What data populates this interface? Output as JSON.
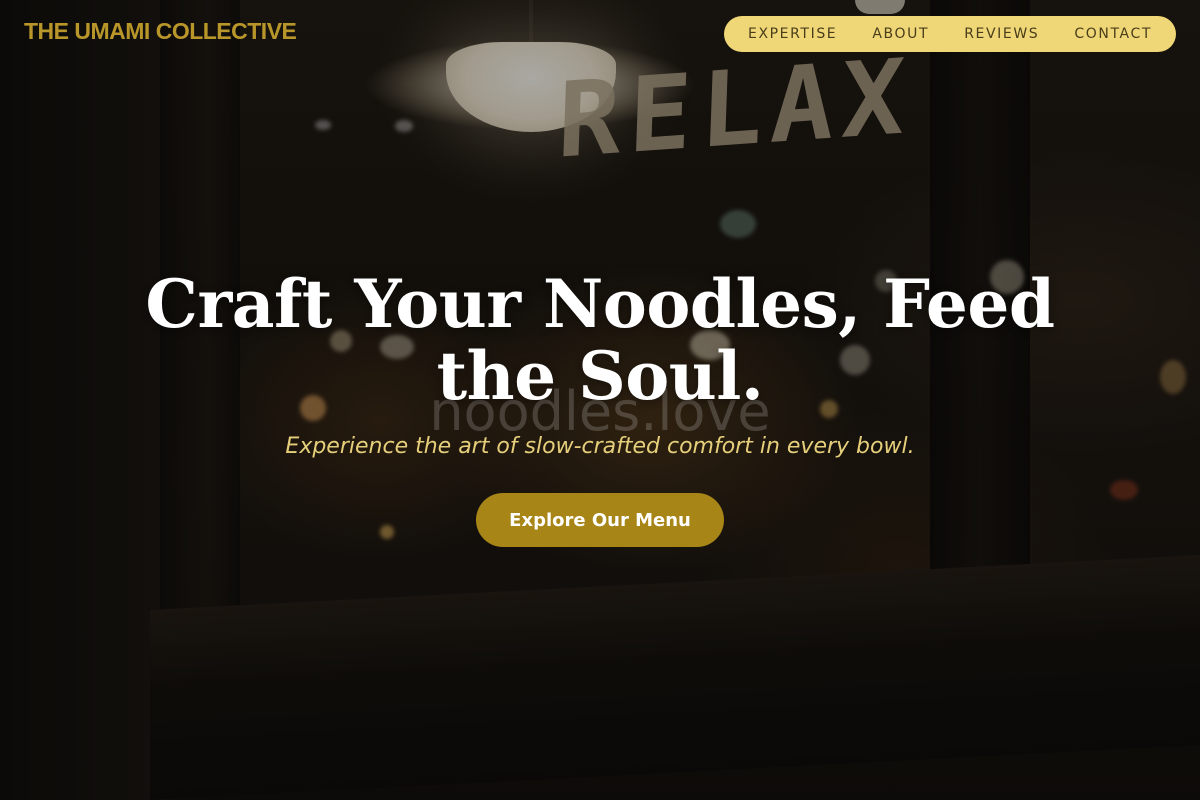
{
  "brand": {
    "name": "THE UMAMI COLLECTIVE",
    "color": "#b9962a"
  },
  "nav": {
    "background": "#efd778",
    "items": [
      {
        "label": "EXPERTISE"
      },
      {
        "label": "ABOUT"
      },
      {
        "label": "REVIEWS"
      },
      {
        "label": "CONTACT"
      }
    ]
  },
  "hero": {
    "headline_line1": "Craft Your Noodles, Feed",
    "headline_line2": "the Soul.",
    "background_text": "noodles.love",
    "window_lettering": "RELAX",
    "subheadline": "Experience the art of slow-crafted comfort in every bowl.",
    "cta_label": "Explore Our Menu",
    "accent_color": "#a88517"
  }
}
